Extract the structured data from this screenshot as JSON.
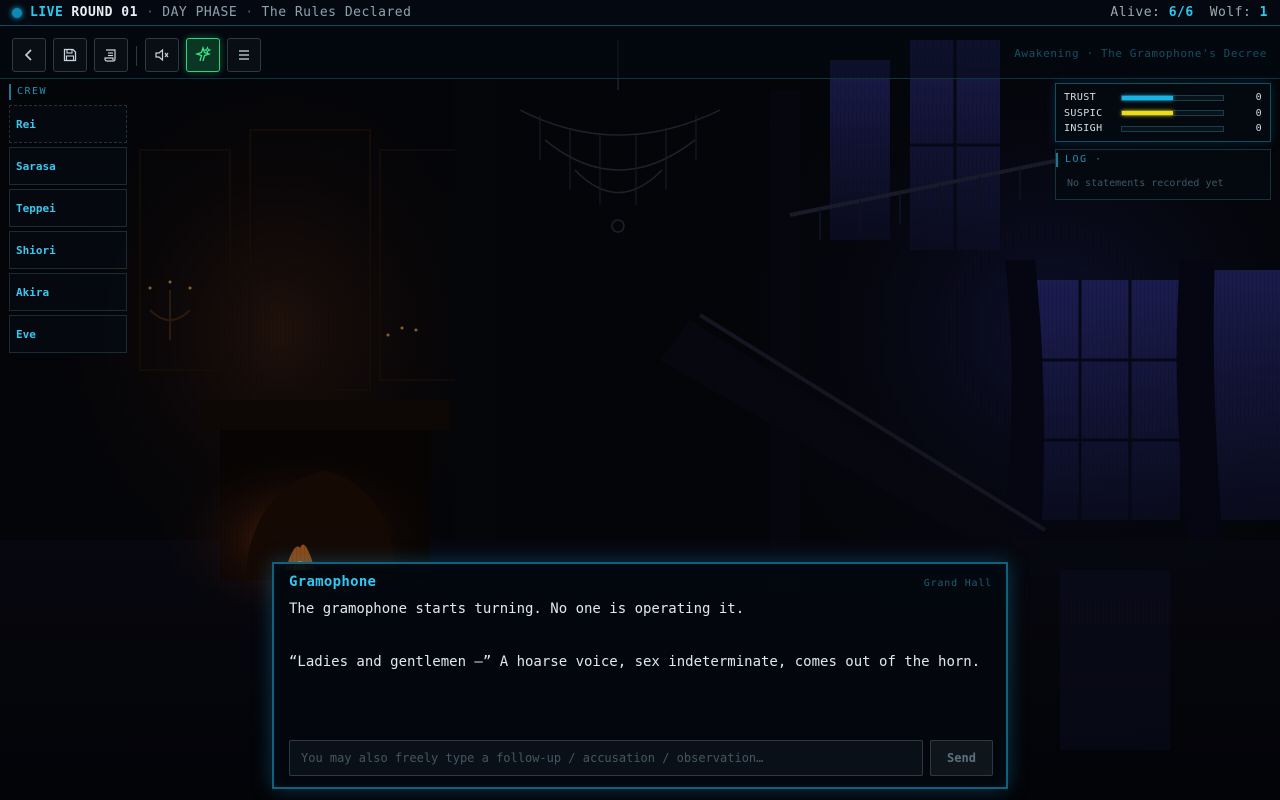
{
  "status_bar": {
    "live": "LIVE",
    "round": "ROUND 01",
    "phase": "DAY PHASE",
    "scene_title": "The Rules Declared",
    "alive_label": "Alive:",
    "alive_value": "6/6",
    "wolf_label": "Wolf:",
    "wolf_value": "1"
  },
  "toolbar": {
    "buttons": [
      {
        "name": "back",
        "icon": "chevron-left-icon"
      },
      {
        "name": "save",
        "icon": "floppy-disk-icon"
      },
      {
        "name": "script",
        "icon": "scroll-icon"
      },
      {
        "name": "mute",
        "icon": "speaker-muted-icon"
      },
      {
        "name": "effects",
        "icon": "sparkles-icon",
        "active": true
      },
      {
        "name": "menu",
        "icon": "hamburger-menu-icon"
      }
    ],
    "chapter": "Awakening · The Gramophone's Decree"
  },
  "crew": {
    "title": "CREW",
    "members": [
      "Rei",
      "Sarasa",
      "Teppei",
      "Shiori",
      "Akira",
      "Eve"
    ]
  },
  "stats": [
    {
      "label": "TRUST",
      "value": "0",
      "fill": 0.5,
      "color": "#19b4e6"
    },
    {
      "label": "SUSPIC",
      "value": "0",
      "fill": 0.5,
      "color": "#f0dc14"
    },
    {
      "label": "INSIGH",
      "value": "0",
      "fill": 0,
      "color": "#19b4e6"
    }
  ],
  "log": {
    "title": "LOG ·",
    "empty": "No statements recorded yet"
  },
  "dialogue": {
    "speaker": "Gramophone",
    "location": "Grand Hall",
    "paragraphs": [
      "The gramophone starts turning. No one is operating it.",
      "“Ladies and gentlemen —” A hoarse voice, sex indeterminate, comes out of the horn."
    ],
    "input_placeholder": "You may also freely type a follow-up / accusation / observation…",
    "send": "Send"
  },
  "colors": {
    "accent": "#28c8f0",
    "active_button": "#2fd37a"
  }
}
